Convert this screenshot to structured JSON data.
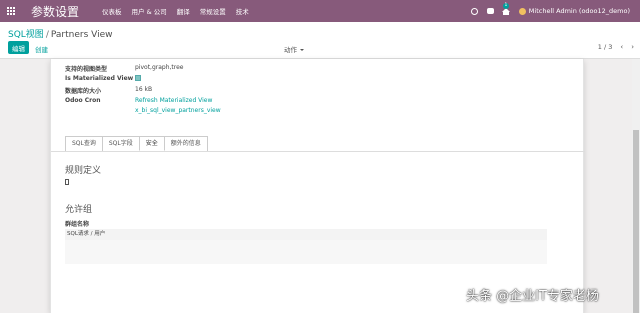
{
  "topbar": {
    "brand": "参数设置",
    "menus": [
      "仪表板",
      "用户 & 公司",
      "翻译",
      "常规设置",
      "技术"
    ],
    "badge": "1",
    "user": "Mitchell Admin (odoo12_demo)"
  },
  "control": {
    "breadcrumb_parent": "SQL视图",
    "breadcrumb_sep": "/",
    "breadcrumb_current": "Partners View",
    "edit_label": "编辑",
    "create_label": "创建",
    "actions_label": "动作",
    "pager": "1 / 3",
    "prev": "‹",
    "next": "›"
  },
  "fields": {
    "view_types_label": "支持的视图类型",
    "view_types_value": "pivot,graph,tree",
    "materialized_label": "Is Materialized View",
    "db_size_label": "数据库的大小",
    "db_size_value": "16 kB",
    "cron_label": "Odoo Cron",
    "cron_link1": "Refresh Materialized View",
    "cron_link2": "x_bi_sql_view_partners_view"
  },
  "tabs": [
    "SQL查询",
    "SQL字段",
    "安全",
    "额外的信息"
  ],
  "security": {
    "rules_title": "规则定义",
    "groups_title": "允许组",
    "group_col": "群组名称",
    "group_row": "SQL请求 / 用户"
  },
  "watermark": "头条 @企业IT专家老杨"
}
